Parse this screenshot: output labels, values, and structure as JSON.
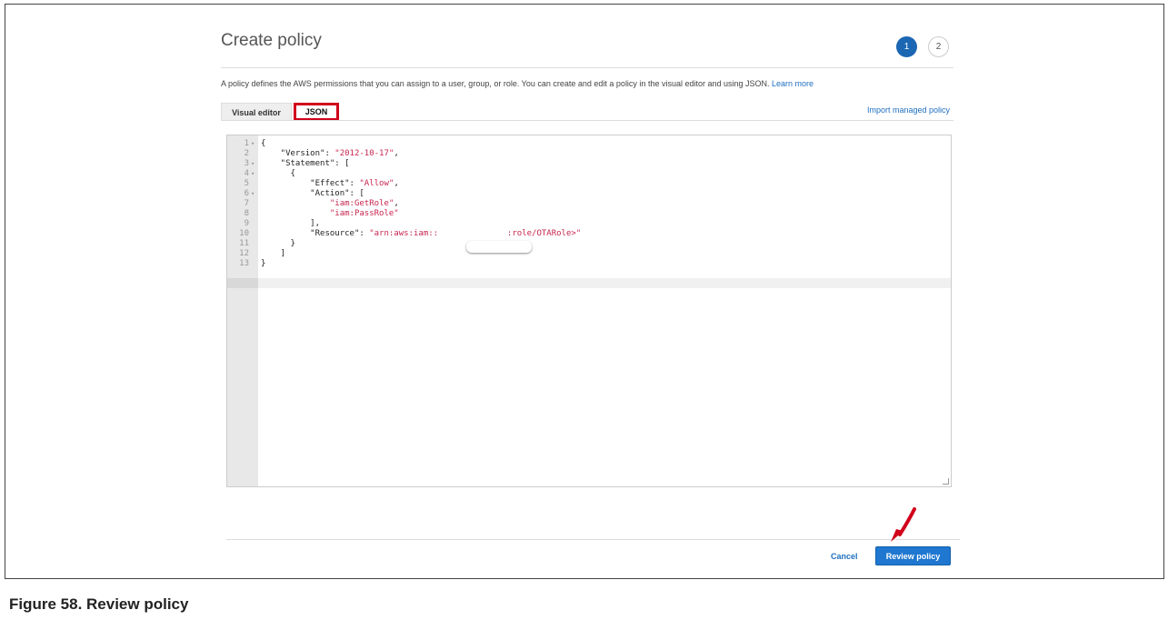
{
  "header": {
    "title": "Create policy",
    "steps": [
      "1",
      "2"
    ]
  },
  "description": {
    "text": "A policy defines the AWS permissions that you can assign to a user, group, or role. You can create and edit a policy in the visual editor and using JSON.",
    "link": "Learn more"
  },
  "tabs": {
    "visual_editor": "Visual editor",
    "json": "JSON",
    "import_link": "Import managed policy"
  },
  "editor": {
    "lines": [
      {
        "n": "1",
        "fold": true,
        "code": "{"
      },
      {
        "n": "2",
        "fold": false,
        "code": "    \"Version\": ",
        "str": "\"2012-10-17\"",
        "tail": ","
      },
      {
        "n": "3",
        "fold": true,
        "code": "    \"Statement\": ["
      },
      {
        "n": "4",
        "fold": true,
        "code": "      {"
      },
      {
        "n": "5",
        "fold": false,
        "code": "          \"Effect\": ",
        "str": "\"Allow\"",
        "tail": ","
      },
      {
        "n": "6",
        "fold": true,
        "code": "          \"Action\": ["
      },
      {
        "n": "7",
        "fold": false,
        "code": "              ",
        "str": "\"iam:GetRole\"",
        "tail": ","
      },
      {
        "n": "8",
        "fold": false,
        "code": "              ",
        "str": "\"iam:PassRole\"",
        "tail": ""
      },
      {
        "n": "9",
        "fold": false,
        "code": "          ],"
      },
      {
        "n": "10",
        "fold": false,
        "code": "          \"Resource\": ",
        "str": "\"arn:aws:iam::              :role/OTARole>\"",
        "tail": ""
      },
      {
        "n": "11",
        "fold": false,
        "code": "      }"
      },
      {
        "n": "12",
        "fold": false,
        "code": "    ]"
      },
      {
        "n": "13",
        "fold": false,
        "code": "}"
      }
    ]
  },
  "footer": {
    "cancel": "Cancel",
    "review": "Review policy"
  },
  "caption": "Figure 58.  Review policy",
  "colors": {
    "primary": "#1f77d0",
    "highlight": "#d0021b",
    "string": "#c7254e"
  }
}
